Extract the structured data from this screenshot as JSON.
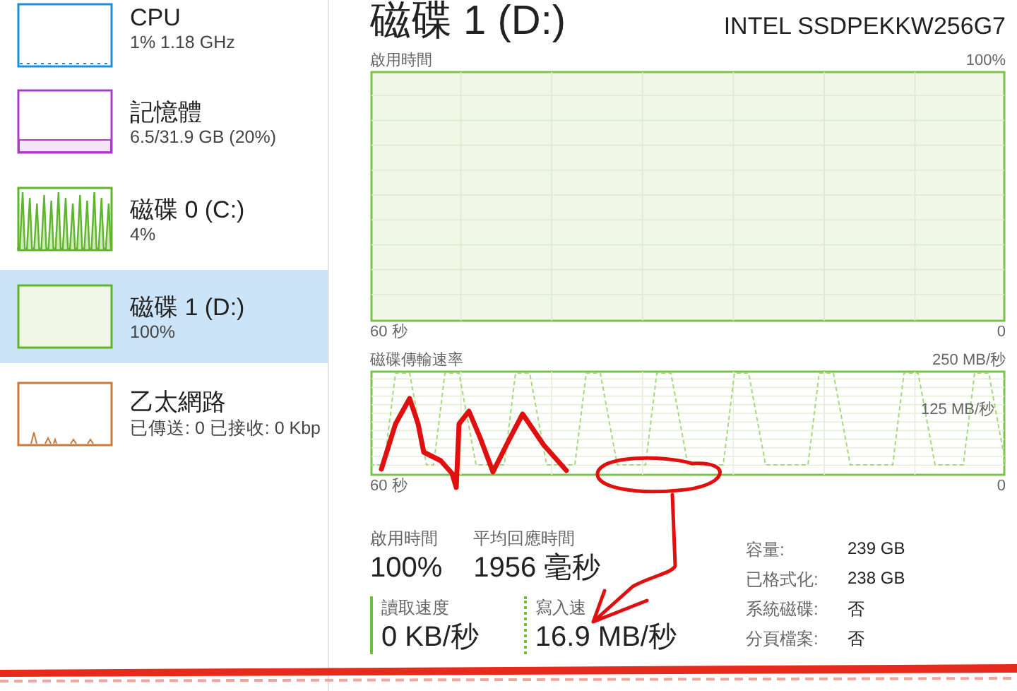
{
  "sidebar": {
    "items": [
      {
        "kind": "flat",
        "title": "CPU",
        "detail": "1% 1.18 GHz",
        "color": "#1e8fd6",
        "selected": false
      },
      {
        "kind": "memory",
        "title": "記憶體",
        "detail": "6.5/31.9 GB (20%)",
        "color": "#a63fc4",
        "selected": false
      },
      {
        "kind": "spikes",
        "title": "磁碟 0 (C:)",
        "detail": "4%",
        "color": "#5fb52b",
        "selected": false
      },
      {
        "kind": "full",
        "title": "磁碟 1 (D:)",
        "detail": "100%",
        "color": "#5fb52b",
        "selected": true
      },
      {
        "kind": "network",
        "title": "乙太網路",
        "detail": "已傳送: 0 已接收: 0 Kbp",
        "color": "#c87b3e",
        "selected": false
      }
    ]
  },
  "header": {
    "title": "磁碟 1 (D:)",
    "model": "INTEL SSDPEKKW256G7"
  },
  "active_time_chart": {
    "label": "啟用時間",
    "max_label": "100%",
    "x_start": "60 秒",
    "x_end": "0"
  },
  "transfer_chart": {
    "label": "磁碟傳輸速率",
    "max_label": "250 MB/秒",
    "mid_label": "125 MB/秒",
    "x_start": "60 秒",
    "x_end": "0"
  },
  "stats": [
    {
      "label": "啟用時間",
      "value": "100%"
    },
    {
      "label": "平均回應時間",
      "value": "1956 毫秒"
    }
  ],
  "rates": [
    {
      "kind": "read",
      "label": "讀取速度",
      "value": "0 KB/秒"
    },
    {
      "kind": "write",
      "label": "寫入速",
      "value": "16.9 MB/秒"
    }
  ],
  "properties": [
    {
      "label": "容量:",
      "value": "239 GB"
    },
    {
      "label": "已格式化:",
      "value": "238 GB"
    },
    {
      "label": "系統磁碟:",
      "value": "否"
    },
    {
      "label": "分頁檔案:",
      "value": "否"
    }
  ]
}
